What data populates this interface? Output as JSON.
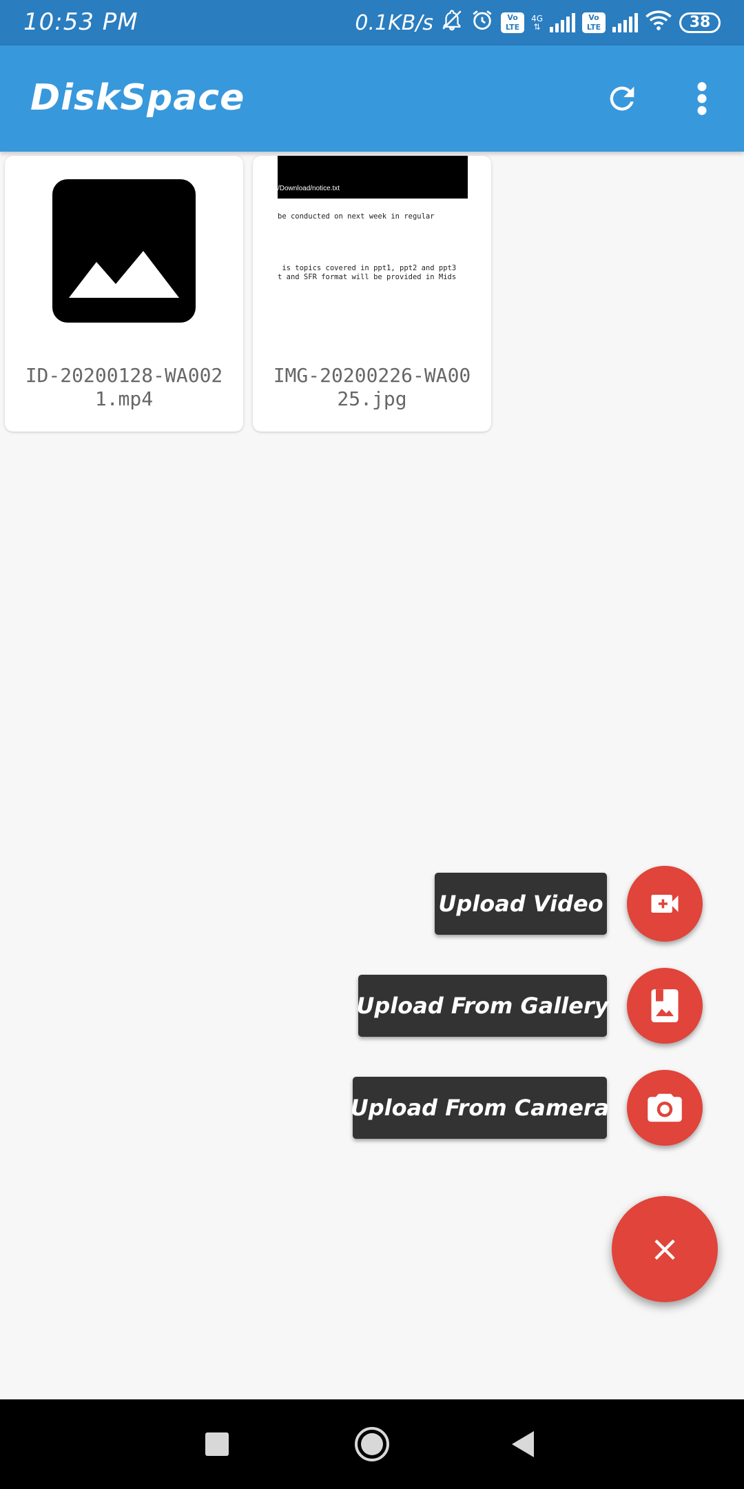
{
  "status_bar": {
    "time": "10:53 PM",
    "net_speed": "0.1KB/s",
    "network_label": "4G",
    "volte_1": "Vo LTE",
    "volte_2": "Vo LTE",
    "battery": "38"
  },
  "app_bar": {
    "title": "DiskSpace",
    "refresh_icon": "refresh-icon",
    "more_icon": "more-vert-icon"
  },
  "files": [
    {
      "name_line1": "ID-20200128-WA002",
      "name_line2": "1.mp4",
      "thumbnail": "image-placeholder-icon"
    },
    {
      "name_line1": "IMG-20200226-WA00",
      "name_line2": "25.jpg",
      "thumbnail": "document-preview",
      "preview": {
        "path": "/Download/notice.txt",
        "line1": "be conducted on next week in regular",
        "line2": " is topics covered in ppt1, ppt2 and ppt3",
        "line3": "t and SFR format will be provided in Mids"
      }
    }
  ],
  "fab_menu": {
    "upload_video": "Upload Video",
    "upload_gallery": "Upload From Gallery",
    "upload_camera": "Upload From Camera",
    "close_symbol": "×"
  },
  "colors": {
    "status_bar": "#2a7dbf",
    "app_bar": "#3898dc",
    "fab": "#e0443a",
    "label_bg": "#333333"
  }
}
